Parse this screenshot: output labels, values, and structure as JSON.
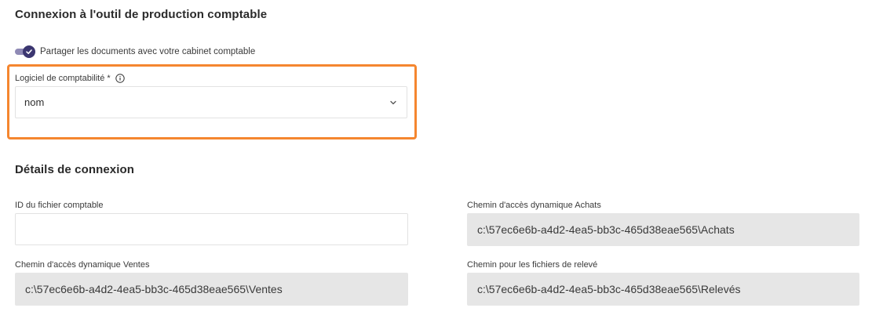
{
  "connection_section": {
    "title": "Connexion à l'outil de production comptable",
    "share_toggle": {
      "checked": true,
      "label": "Partager les documents avec votre cabinet comptable"
    },
    "accounting_software": {
      "label": "Logiciel de comptabilité *",
      "selected_value": "nom"
    }
  },
  "details_section": {
    "title": "Détails de connexion",
    "fields": {
      "file_id": {
        "label": "ID du fichier comptable",
        "value": "",
        "placeholder": ""
      },
      "purchases_path": {
        "label": "Chemin d'accès dynamique Achats",
        "value": "c:\\57ec6e6b-a4d2-4ea5-bb3c-465d38eae565\\Achats"
      },
      "sales_path": {
        "label": "Chemin d'accès dynamique Ventes",
        "value": "c:\\57ec6e6b-a4d2-4ea5-bb3c-465d38eae565\\Ventes"
      },
      "statements_path": {
        "label": "Chemin pour les fichiers de relevé",
        "value": "c:\\57ec6e6b-a4d2-4ea5-bb3c-465d38eae565\\Relevés"
      }
    }
  },
  "colors": {
    "accent": "#3b3670",
    "toggle_track": "#8f8ab5",
    "highlight": "#f5862f",
    "readonly_bg": "#e6e6e6"
  },
  "icons": {
    "toggle_check": "check-icon",
    "info": "info-icon",
    "dropdown": "chevron-down-icon"
  }
}
